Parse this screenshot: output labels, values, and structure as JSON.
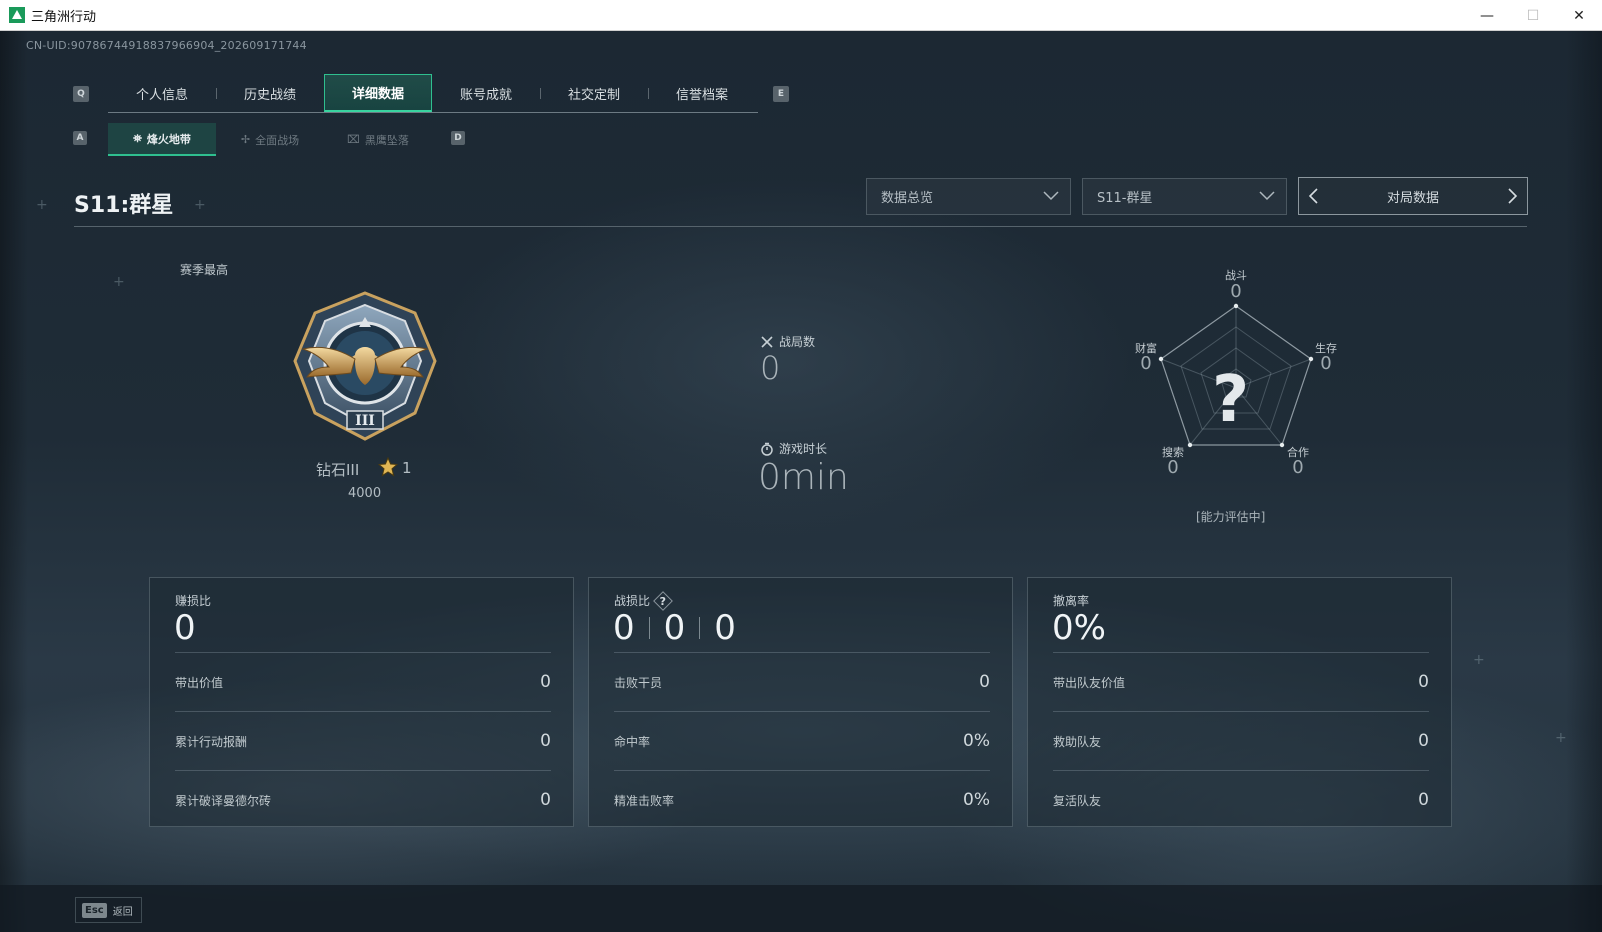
{
  "window": {
    "title": "三角洲行动",
    "minimize": "—",
    "maximize": "☐",
    "close": "✕"
  },
  "uid": "CN-UID:9078674491883796690​4_202609171744",
  "tabs": {
    "prev_key": "Q",
    "next_key": "E",
    "items": [
      {
        "label": "个人信息",
        "active": false
      },
      {
        "label": "历史战绩",
        "active": false
      },
      {
        "label": "详细数据",
        "active": true
      },
      {
        "label": "账号成就",
        "active": false
      },
      {
        "label": "社交定制",
        "active": false
      },
      {
        "label": "信誉档案",
        "active": false
      }
    ]
  },
  "subtabs": {
    "prev_key": "A",
    "next_key": "D",
    "items": [
      {
        "label": "烽火地带",
        "icon": "hazard-icon",
        "active": true
      },
      {
        "label": "全面战场",
        "icon": "battlefield-icon",
        "active": false
      },
      {
        "label": "黑鹰坠落",
        "icon": "helicopter-icon",
        "active": false
      }
    ]
  },
  "season": {
    "title": "S11:群星"
  },
  "filters": {
    "overview": "数据总览",
    "season": "S11-群星",
    "pager_label": "对局数据"
  },
  "rank": {
    "section_label": "赛季最高",
    "name": "钻石III",
    "stars": "1",
    "points": "4000"
  },
  "center_stats": {
    "matches_label": "战局数",
    "matches_value": "0",
    "playtime_label": "游戏时长",
    "playtime_value": "0min"
  },
  "radar": {
    "axes": [
      {
        "label": "战斗",
        "value": "0"
      },
      {
        "label": "生存",
        "value": "0"
      },
      {
        "label": "合作",
        "value": "0"
      },
      {
        "label": "搜索",
        "value": "0"
      },
      {
        "label": "财富",
        "value": "0"
      }
    ],
    "center": "?",
    "note": "[能力评估中]"
  },
  "panels": [
    {
      "title": "赚损比",
      "big": "0",
      "rows": [
        {
          "label": "带出价值",
          "value": "0"
        },
        {
          "label": "累计行动报酬",
          "value": "0"
        },
        {
          "label": "累计破译曼德尔砖",
          "value": "0"
        }
      ]
    },
    {
      "title": "战损比",
      "big_parts": [
        "0",
        "0",
        "0"
      ],
      "help": "?",
      "rows": [
        {
          "label": "击败干员",
          "value": "0"
        },
        {
          "label": "命中率",
          "value": "0%"
        },
        {
          "label": "精准击败率",
          "value": "0%"
        }
      ]
    },
    {
      "title": "撤离率",
      "big": "0%",
      "rows": [
        {
          "label": "带出队友价值",
          "value": "0"
        },
        {
          "label": "救助队友",
          "value": "0"
        },
        {
          "label": "复活队友",
          "value": "0"
        }
      ]
    }
  ],
  "footer": {
    "esc_key": "Esc",
    "esc_label": "返回"
  },
  "colors": {
    "accent": "#2fbf8f",
    "background": "#1f2c37"
  }
}
